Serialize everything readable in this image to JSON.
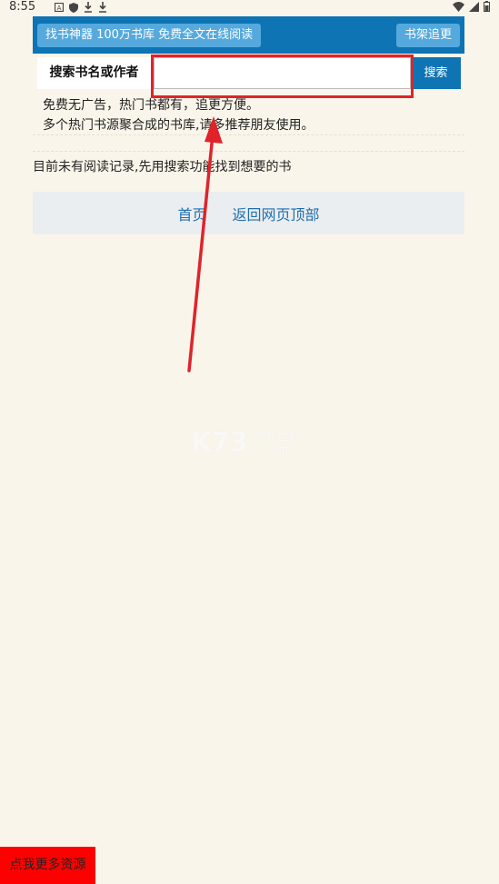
{
  "status_bar": {
    "time": "8:55"
  },
  "top_bar": {
    "left_button": "找书神器 100万书库 免费全文在线阅读",
    "right_button": "书架追更"
  },
  "search": {
    "label": "搜索书名或作者",
    "value": "",
    "placeholder": "",
    "button": "搜索"
  },
  "notice": {
    "line1": "免费无广告，热门书都有，追更方便。",
    "line2": "多个热门书源聚合成的书库,请多推荐朋友使用。"
  },
  "no_record_text": "目前未有阅读记录,先用搜索功能找到想要的书",
  "footer_nav": {
    "home": "首页",
    "back_to_top": "返回网页顶部"
  },
  "watermark": {
    "main": "K73",
    "sub": "游戏之家",
    "domain": ".com"
  },
  "more_button": "点我更多资源",
  "colors": {
    "background": "#faf5ea",
    "top_bar": "#0e74b4",
    "top_button": "#55a9dd",
    "highlight": "#e0232a",
    "link": "#1f6fae",
    "more_button": "#ff0000"
  }
}
